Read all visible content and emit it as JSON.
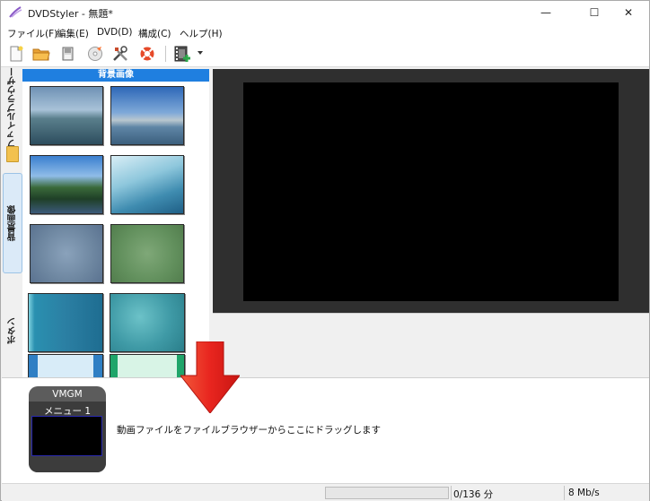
{
  "window": {
    "title": "DVDStyler - 無題*"
  },
  "controls": {
    "minimize": "—",
    "maximize": "☐",
    "close": "✕"
  },
  "menu": [
    {
      "label": "ファイル(F)"
    },
    {
      "label": "編集(E)"
    },
    {
      "label": "DVD(D)"
    },
    {
      "label": "構成(C)"
    },
    {
      "label": "ヘルプ(H)"
    }
  ],
  "toolbar": {
    "icons": [
      "new-file-icon",
      "open-folder-icon",
      "save-icon",
      "burn-disc-icon",
      "settings-tools-icon",
      "help-lifebuoy-icon",
      "add-video-icon"
    ]
  },
  "tabs": [
    {
      "label": "ファイルブラウザー"
    },
    {
      "label": "背景画像"
    },
    {
      "label": "ボタン"
    }
  ],
  "background_panel": {
    "header": "背景画像",
    "thumbnails": [
      "sea-island",
      "boat-bay",
      "lake-forest",
      "blue-waves",
      "blue-blur",
      "green-blur",
      "teal-stripes",
      "teal-texture",
      "blue-frame",
      "green-frame"
    ]
  },
  "titleset": {
    "vmgm_label": "VMGM",
    "menu_label": "メニュー 1",
    "hint": "動画ファイルをファイルブラウザーからここにドラッグします"
  },
  "status": {
    "duration": "0/136 分",
    "bitrate": "8 Mb/s"
  },
  "colors": {
    "accent": "#1f7fe0",
    "arrow": "#e8251f",
    "preview_bg": "#2f2f2f"
  }
}
